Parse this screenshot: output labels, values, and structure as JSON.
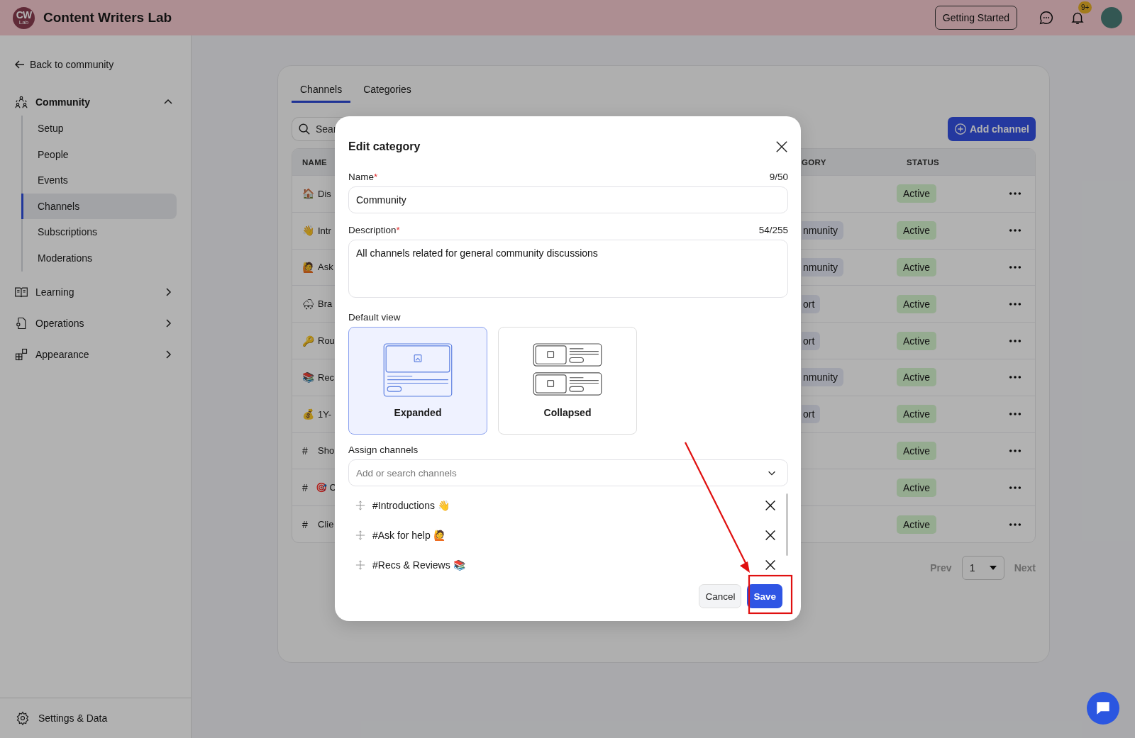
{
  "header": {
    "logo": {
      "initials": "CW",
      "sub": "Lab"
    },
    "title": "Content Writers Lab",
    "getting_started": "Getting Started",
    "notification_badge": "9+"
  },
  "sidebar": {
    "back": "Back to community",
    "groups": [
      {
        "label": "Community",
        "expanded": true,
        "children": [
          {
            "label": "Setup",
            "selected": false
          },
          {
            "label": "People",
            "selected": false
          },
          {
            "label": "Events",
            "selected": false
          },
          {
            "label": "Channels",
            "selected": true
          },
          {
            "label": "Subscriptions",
            "selected": false
          },
          {
            "label": "Moderations",
            "selected": false
          }
        ]
      },
      {
        "label": "Learning",
        "expanded": false
      },
      {
        "label": "Operations",
        "expanded": false
      },
      {
        "label": "Appearance",
        "expanded": false
      }
    ],
    "footer": "Settings & Data"
  },
  "tabs": [
    {
      "label": "Channels",
      "selected": true
    },
    {
      "label": "Categories",
      "selected": false
    }
  ],
  "search": {
    "placeholder": "Sear"
  },
  "add_channel": "Add channel",
  "table": {
    "columns": [
      "NAME",
      "GORY",
      "STATUS"
    ],
    "rows": [
      {
        "icon": "🏠",
        "name": "Dis",
        "status": "Active"
      },
      {
        "icon": "👋",
        "name": "Intr",
        "category": "nmunity",
        "status": "Active"
      },
      {
        "icon": "🙋",
        "name": "Ask",
        "category": "nmunity",
        "status": "Active"
      },
      {
        "icon": "🌨",
        "name": "Bra",
        "category": "ort",
        "status": "Active"
      },
      {
        "icon": "🔑",
        "name": "Rou",
        "category": "ort",
        "status": "Active"
      },
      {
        "icon": "📚",
        "name": "Rec",
        "category": "nmunity",
        "status": "Active"
      },
      {
        "icon": "💰",
        "name": "1Y-",
        "category": "ort",
        "status": "Active"
      },
      {
        "icon": "#",
        "name": "Sho",
        "status": "Active"
      },
      {
        "icon": "#",
        "name": "🎯 C",
        "status": "Active"
      },
      {
        "icon": "#",
        "name": "Clie",
        "status": "Active"
      }
    ]
  },
  "pagination": {
    "prev": "Prev",
    "page": "1",
    "next": "Next"
  },
  "modal": {
    "title": "Edit category",
    "name_field": {
      "label": "Name",
      "required_mark": "*",
      "counter": "9/50",
      "value": "Community"
    },
    "description_field": {
      "label": "Description",
      "required_mark": "*",
      "counter": "54/255",
      "value": "All channels related for general community discussions"
    },
    "default_view": {
      "label": "Default view",
      "options": [
        {
          "kind": "expanded",
          "label": "Expanded",
          "selected": true
        },
        {
          "kind": "collapsed",
          "label": "Collapsed",
          "selected": false
        }
      ]
    },
    "assign_channels": {
      "label": "Assign channels",
      "placeholder": "Add or search channels",
      "items": [
        "#Introductions 👋",
        "#Ask for help 🙋",
        "#Recs & Reviews 📚"
      ]
    },
    "buttons": {
      "cancel": "Cancel",
      "save": "Save"
    }
  }
}
